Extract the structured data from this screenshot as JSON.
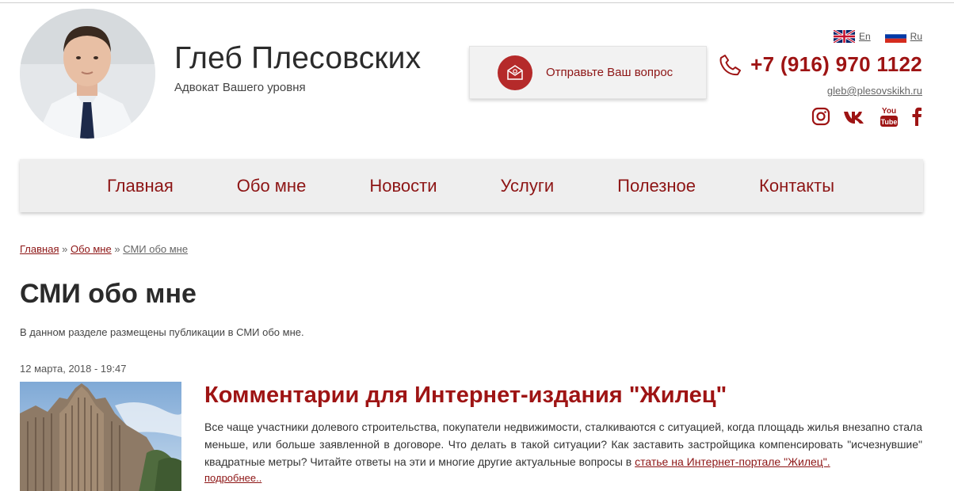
{
  "header": {
    "name": "Глеб Плесовских",
    "tagline": "Адвокат Вашего уровня",
    "ask_button_label": "Отправьте Ваш вопрос",
    "languages": [
      {
        "code": "en",
        "label": "En"
      },
      {
        "code": "ru",
        "label": "Ru"
      }
    ],
    "phone": "+7 (916) 970 1122",
    "email": "gleb@plesovskikh.ru",
    "socials": [
      "instagram-icon",
      "vk-icon",
      "youtube-icon",
      "facebook-icon"
    ]
  },
  "nav": {
    "items": [
      "Главная",
      "Обо мне",
      "Новости",
      "Услуги",
      "Полезное",
      "Контакты"
    ]
  },
  "breadcrumb": {
    "home": "Главная",
    "sep": "»",
    "about": "Обо мне",
    "current": "СМИ обо мне"
  },
  "page": {
    "title": "СМИ обо мне",
    "intro": "В данном разделе размещены публикации в СМИ обо мне."
  },
  "article": {
    "date": "12 марта, 2018 - 19:47",
    "title": "Комментарии для Интернет-издания \"Жилец\"",
    "body": "Все чаще участники долевого строительства, покупатели недвижимости, сталкиваются с ситуацией, когда площадь жилья внезапно стала меньше, или больше заявленной в договоре. Что делать в такой ситуации? Как заставить застройщика компенсировать \"исчезнувшие\" квадратные метры? Читайте ответы на эти и многие другие актуальные вопросы в ",
    "link_text": "статье на Интернет-портале \"Жилец\".",
    "more": "подробнее.."
  },
  "colors": {
    "accent": "#9e1414",
    "accent_dark": "#8d1515",
    "nav_bg": "#eeeeee",
    "mail_circle": "#b52a2a"
  }
}
